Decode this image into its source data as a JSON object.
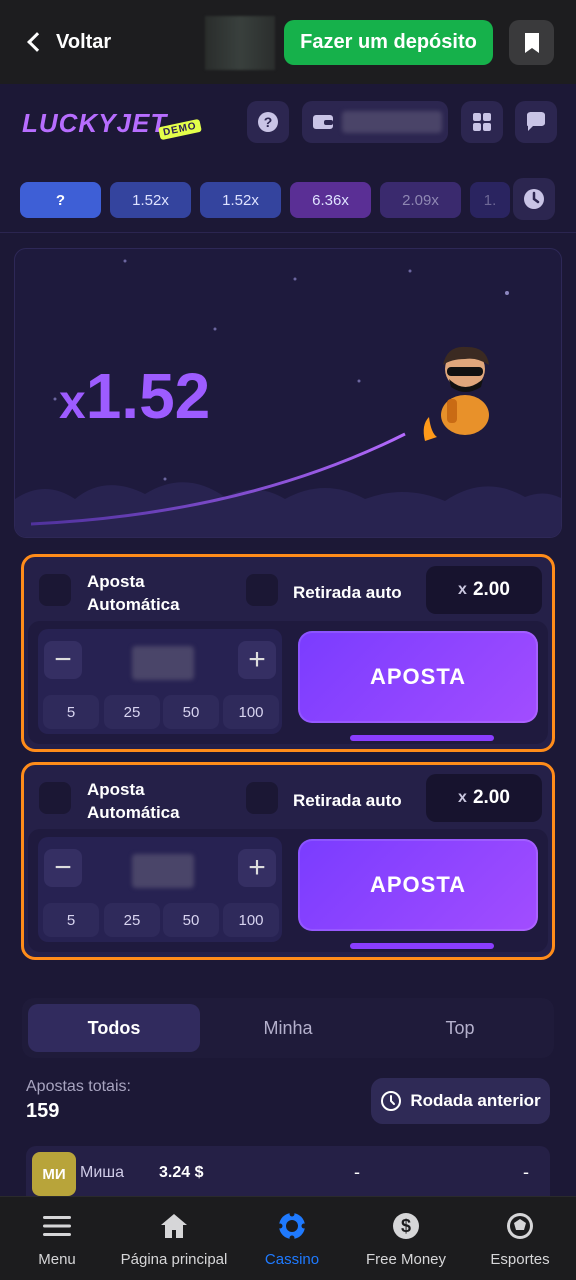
{
  "header": {
    "back_label": "Voltar",
    "deposit_label": "Fazer um depósito"
  },
  "game": {
    "logo": "LUCKYJET",
    "logo_badge": "DEMO",
    "history": [
      {
        "label": "?",
        "color": "#3e5fd6"
      },
      {
        "label": "1.52x",
        "color": "#34449e"
      },
      {
        "label": "1.52x",
        "color": "#34449e"
      },
      {
        "label": "6.36x",
        "color": "#5a2f95"
      },
      {
        "label": "2.09x",
        "color": "#3a2a6e"
      },
      {
        "label": "1.",
        "color": "#2a2460"
      }
    ],
    "multiplier_prefix": "x",
    "multiplier_value": "1.52"
  },
  "bet_panels": [
    {
      "auto_bet_label_1": "Aposta",
      "auto_bet_label_2": "Automática",
      "auto_cashout_label": "Retirada auto",
      "coef_prefix": "x",
      "coef_value": "2.00",
      "minus": "−",
      "plus": "+",
      "quick": [
        "5",
        "25",
        "50",
        "100"
      ],
      "bet_button": "APOSTA"
    },
    {
      "auto_bet_label_1": "Aposta",
      "auto_bet_label_2": "Automática",
      "auto_cashout_label": "Retirada auto",
      "coef_prefix": "x",
      "coef_value": "2.00",
      "minus": "−",
      "plus": "+",
      "quick": [
        "5",
        "25",
        "50",
        "100"
      ],
      "bet_button": "APOSTA"
    }
  ],
  "bets_section": {
    "tabs": [
      "Todos",
      "Minha",
      "Top"
    ],
    "total_label": "Apostas totais:",
    "total_value": "159",
    "prev_round_label": "Rodada anterior",
    "rows": [
      {
        "avatar": "МИ",
        "name": "Миша",
        "amount": "3.24 $",
        "coef": "-",
        "win": "-"
      }
    ]
  },
  "bottom_nav": {
    "items": [
      {
        "label": "Menu",
        "icon": "menu-icon"
      },
      {
        "label": "Página principal",
        "icon": "home-icon"
      },
      {
        "label": "Cassino",
        "icon": "casino-icon"
      },
      {
        "label": "Free Money",
        "icon": "dollar-icon"
      },
      {
        "label": "Esportes",
        "icon": "soccer-icon"
      }
    ],
    "active_color": "#1f7aff"
  },
  "colors": {
    "deposit_green": "#16b14b",
    "accent_purple": "#9d5cff",
    "panel_border_orange": "#ff8c1a"
  }
}
